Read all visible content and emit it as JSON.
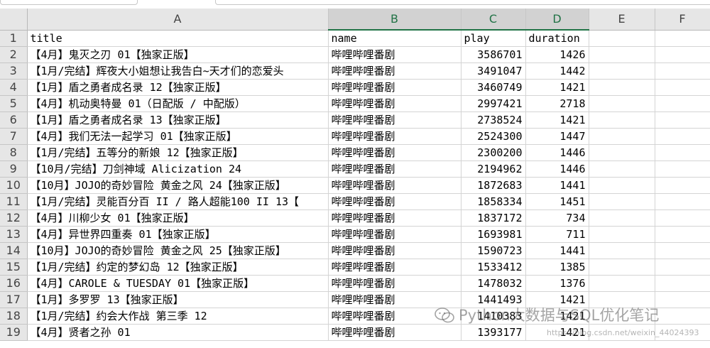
{
  "columns": [
    "A",
    "B",
    "C",
    "D",
    "E",
    "F"
  ],
  "selected_columns": [
    "B",
    "C",
    "D"
  ],
  "header_row": {
    "row_num": "1",
    "cells": [
      "title",
      "name",
      "play",
      "duration",
      "",
      ""
    ]
  },
  "rows": [
    {
      "row_num": "2",
      "cells": [
        "【4月】鬼灭之刃 01【独家正版】",
        "哔哩哔哩番剧",
        "3586701",
        "1426",
        "",
        ""
      ]
    },
    {
      "row_num": "3",
      "cells": [
        "【1月/完结】辉夜大小姐想让我告白~天才们的恋爱头",
        "哔哩哔哩番剧",
        "3491047",
        "1442",
        "",
        ""
      ]
    },
    {
      "row_num": "4",
      "cells": [
        "【1月】盾之勇者成名录 12【独家正版】",
        "哔哩哔哩番剧",
        "3460749",
        "1421",
        "",
        ""
      ]
    },
    {
      "row_num": "5",
      "cells": [
        "【4月】机动奥特曼 01（日配版 / 中配版）",
        "哔哩哔哩番剧",
        "2997421",
        "2718",
        "",
        ""
      ]
    },
    {
      "row_num": "6",
      "cells": [
        "【1月】盾之勇者成名录 13【独家正版】",
        "哔哩哔哩番剧",
        "2738524",
        "1421",
        "",
        ""
      ]
    },
    {
      "row_num": "7",
      "cells": [
        "【4月】我们无法一起学习 01【独家正版】",
        "哔哩哔哩番剧",
        "2524300",
        "1447",
        "",
        ""
      ]
    },
    {
      "row_num": "8",
      "cells": [
        "【1月/完结】五等分的新娘 12【独家正版】",
        "哔哩哔哩番剧",
        "2300200",
        "1446",
        "",
        ""
      ]
    },
    {
      "row_num": "9",
      "cells": [
        "【10月/完结】刀剑神域 Alicization 24",
        "哔哩哔哩番剧",
        "2194962",
        "1446",
        "",
        ""
      ]
    },
    {
      "row_num": "10",
      "cells": [
        "【10月】JOJO的奇妙冒险 黄金之风 24【独家正版】",
        "哔哩哔哩番剧",
        "1872683",
        "1441",
        "",
        ""
      ]
    },
    {
      "row_num": "11",
      "cells": [
        "【1月/完结】灵能百分百 II / 路人超能100 II 13【",
        "哔哩哔哩番剧",
        "1858334",
        "1451",
        "",
        ""
      ]
    },
    {
      "row_num": "12",
      "cells": [
        "【4月】川柳少女 01【独家正版】",
        "哔哩哔哩番剧",
        "1837172",
        "734",
        "",
        ""
      ]
    },
    {
      "row_num": "13",
      "cells": [
        "【4月】异世界四重奏 01【独家正版】",
        "哔哩哔哩番剧",
        "1693981",
        "711",
        "",
        ""
      ]
    },
    {
      "row_num": "14",
      "cells": [
        "【10月】JOJO的奇妙冒险 黄金之风 25【独家正版】",
        "哔哩哔哩番剧",
        "1590723",
        "1441",
        "",
        ""
      ]
    },
    {
      "row_num": "15",
      "cells": [
        "【1月/完结】约定的梦幻岛 12【独家正版】",
        "哔哩哔哩番剧",
        "1533412",
        "1385",
        "",
        ""
      ]
    },
    {
      "row_num": "16",
      "cells": [
        "【4月】CAROLE & TUESDAY 01【独家正版】",
        "哔哩哔哩番剧",
        "1478032",
        "1376",
        "",
        ""
      ]
    },
    {
      "row_num": "17",
      "cells": [
        "【1月】多罗罗 13【独家正版】",
        "哔哩哔哩番剧",
        "1441493",
        "1421",
        "",
        ""
      ]
    },
    {
      "row_num": "18",
      "cells": [
        "【1月/完结】约会大作战 第三季 12",
        "哔哩哔哩番剧",
        "1410383",
        "1421",
        "",
        ""
      ]
    },
    {
      "row_num": "19",
      "cells": [
        "【4月】贤者之孙 01",
        "哔哩哔哩番剧",
        "1393177",
        "1421",
        "",
        ""
      ]
    }
  ],
  "watermark": {
    "text": "Python大数据与SQL优化笔记",
    "subtext": "https://blog.csdn.net/weixin_44024393"
  },
  "colors": {
    "header_bg": "#e6e6e6",
    "selected_header_bg": "#d2d2d2",
    "accent": "#217346",
    "gridline": "#d4d4d4"
  }
}
